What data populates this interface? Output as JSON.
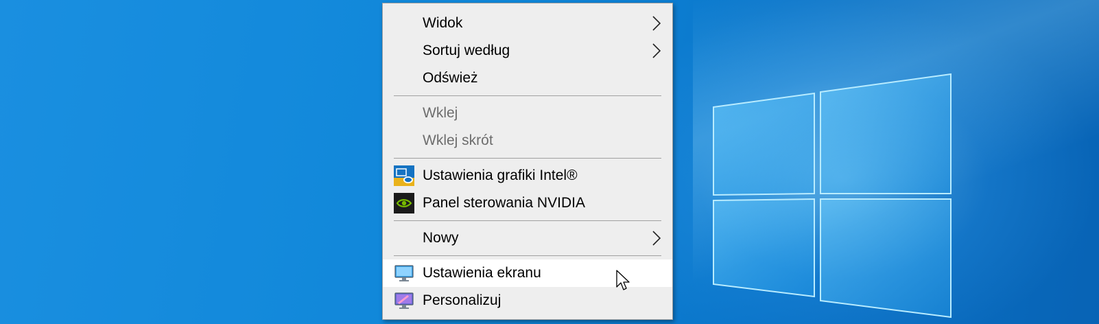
{
  "context_menu": {
    "items": [
      {
        "label": "Widok",
        "submenu": true
      },
      {
        "label": "Sortuj według",
        "submenu": true
      },
      {
        "label": "Odśwież"
      },
      {
        "label": "Wklej",
        "disabled": true
      },
      {
        "label": "Wklej skrót",
        "disabled": true
      },
      {
        "label": "Ustawienia grafiki Intel®",
        "icon": "intel-graphics-icon"
      },
      {
        "label": "Panel sterowania NVIDIA",
        "icon": "nvidia-icon"
      },
      {
        "label": "Nowy",
        "submenu": true
      },
      {
        "label": "Ustawienia ekranu",
        "icon": "display-settings-icon",
        "hovered": true
      },
      {
        "label": "Personalizuj",
        "icon": "personalize-icon"
      }
    ]
  },
  "colors": {
    "desktop_blue": "#0f86d8",
    "menu_background": "#eeeeee",
    "menu_hover": "#ffffff",
    "disabled_text": "#6d6d6d"
  }
}
